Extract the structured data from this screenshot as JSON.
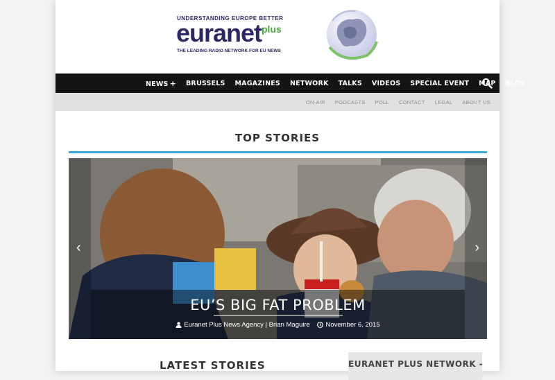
{
  "header": {
    "tagline_top": "UNDERSTANDING EUROPE BETTER",
    "brand": "euranet",
    "brand_suffix": "plus",
    "tagline_bottom": "THE LEADING RADIO NETWORK FOR EU NEWS"
  },
  "nav": {
    "items": [
      "NEWS",
      "BRUSSELS",
      "MAGAZINES",
      "NETWORK",
      "TALKS",
      "VIDEOS",
      "SPECIAL EVENT",
      "MAP",
      "BLOG"
    ],
    "news_plus": "+"
  },
  "subnav": {
    "items": [
      "ON-AIR",
      "PODCASTS",
      "POLL",
      "CONTACT",
      "LEGAL",
      "ABOUT US"
    ]
  },
  "top_stories": {
    "title": "TOP STORIES",
    "headline": "EU’S BIG FAT PROBLEM",
    "author": "Euranet Plus News Agency | Brian Maguire",
    "date": "November 6, 2015",
    "prev_arrow": "‹",
    "next_arrow": "›"
  },
  "latest": {
    "title": "LATEST STORIES"
  },
  "sidebar": {
    "widget_title": "EURANET PLUS NETWORK -"
  },
  "colors": {
    "accent": "#3aa7e0",
    "brand": "#2d2766",
    "brand_green": "#4aa63a",
    "nav_bg": "#141414"
  }
}
